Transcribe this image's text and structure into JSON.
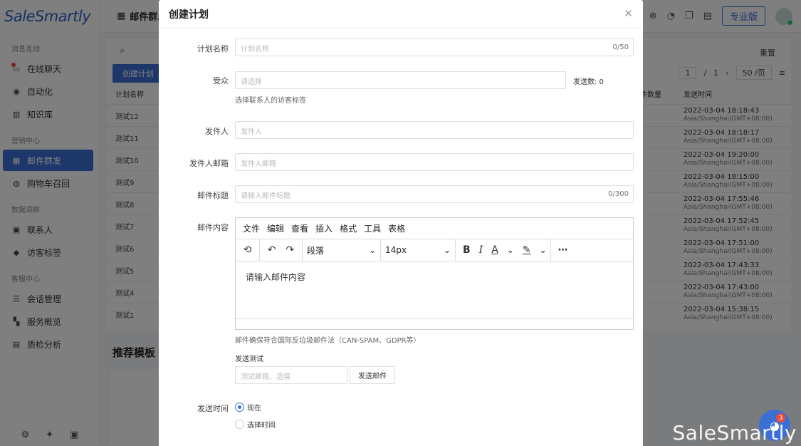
{
  "app": {
    "logo": "SaleSmartly",
    "sidebar": {
      "sections": [
        {
          "title": "消息互动",
          "items": [
            "在线聊天",
            "自动化",
            "知识库"
          ]
        },
        {
          "title": "营销中心",
          "items": [
            "邮件群发",
            "购物车召回"
          ]
        },
        {
          "title": "数据洞察",
          "items": [
            "联系人",
            "访客标签"
          ]
        },
        {
          "title": "客服中心",
          "items": [
            "会话管理",
            "服务概览",
            "质检分析"
          ]
        }
      ],
      "active": "邮件群发"
    },
    "topbar": {
      "title": "邮件群发",
      "pro_label": "专业版"
    },
    "list": {
      "create_label": "创建计划",
      "reset_label": "重置",
      "pager": {
        "page": "1",
        "total": "1",
        "per_page": "50 /页"
      },
      "col_name": "计划名称",
      "col_count": "件数量",
      "col_time": "发送时间",
      "rows": [
        {
          "name": "测试12",
          "time": "2022-03-04 18:18:43",
          "tz": "Asia/Shanghai(GMT+08:00)"
        },
        {
          "name": "测试11",
          "time": "2022-03-04 18:18:17",
          "tz": "Asia/Shanghai(GMT+08:00)"
        },
        {
          "name": "测试10",
          "time": "2022-03-04 19:20:00",
          "tz": "Asia/Shanghai(GMT+08:00)"
        },
        {
          "name": "测试9",
          "time": "2022-03-04 18:15:00",
          "tz": "Asia/Shanghai(GMT+08:00)"
        },
        {
          "name": "测试8",
          "time": "2022-03-04 17:55:46",
          "tz": "Asia/Shanghai(GMT+08:00)"
        },
        {
          "name": "测试7",
          "time": "2022-03-04 17:52:45",
          "tz": "Asia/Shanghai(GMT+08:00)"
        },
        {
          "name": "测试6",
          "time": "2022-03-04 17:51:00",
          "tz": "Asia/Shanghai(GMT+08:00)"
        },
        {
          "name": "测试5",
          "time": "2022-03-04 17:43:33",
          "tz": "Asia/Shanghai(GMT+08:00)"
        },
        {
          "name": "测试4",
          "time": "2022-03-04 17:43:00",
          "tz": "Asia/Shanghai(GMT+08:00)"
        },
        {
          "name": "测试1",
          "time": "2022-03-04 15:38:15",
          "tz": "Asia/Shanghai(GMT+08:00)"
        }
      ],
      "rec_title": "推荐模板"
    }
  },
  "modal": {
    "title": "创建计划",
    "fields": {
      "plan_name": {
        "label": "计划名称",
        "placeholder": "计划名称",
        "counter": "0/50"
      },
      "audience": {
        "label": "受众",
        "placeholder": "请选择",
        "send_count": "发送数: 0",
        "hint": "选择联系人的访客标签"
      },
      "sender": {
        "label": "发件人",
        "placeholder": "发件人"
      },
      "sender_email": {
        "label": "发件人邮箱",
        "placeholder": "发件人邮箱"
      },
      "subject": {
        "label": "邮件标题",
        "placeholder": "请输入邮件标题",
        "counter": "0/300"
      },
      "content": {
        "label": "邮件内容",
        "placeholder": "请输入邮件内容",
        "hint": "邮件确保符合国际反垃圾邮件法（CAN-SPAM、GDPR等）"
      }
    },
    "editor": {
      "menus": [
        "文件",
        "编辑",
        "查看",
        "插入",
        "格式",
        "工具",
        "表格"
      ],
      "block_format": "段落",
      "font_size": "14px"
    },
    "send_test": {
      "label": "发送测试",
      "placeholder": "测试邮箱，选填",
      "button": "发送邮件"
    },
    "send_time": {
      "label": "发送时间",
      "options": [
        "现在",
        "选择时间"
      ],
      "selected": "现在"
    }
  },
  "watermark": "SaleSmartly",
  "chat_badge": "3"
}
